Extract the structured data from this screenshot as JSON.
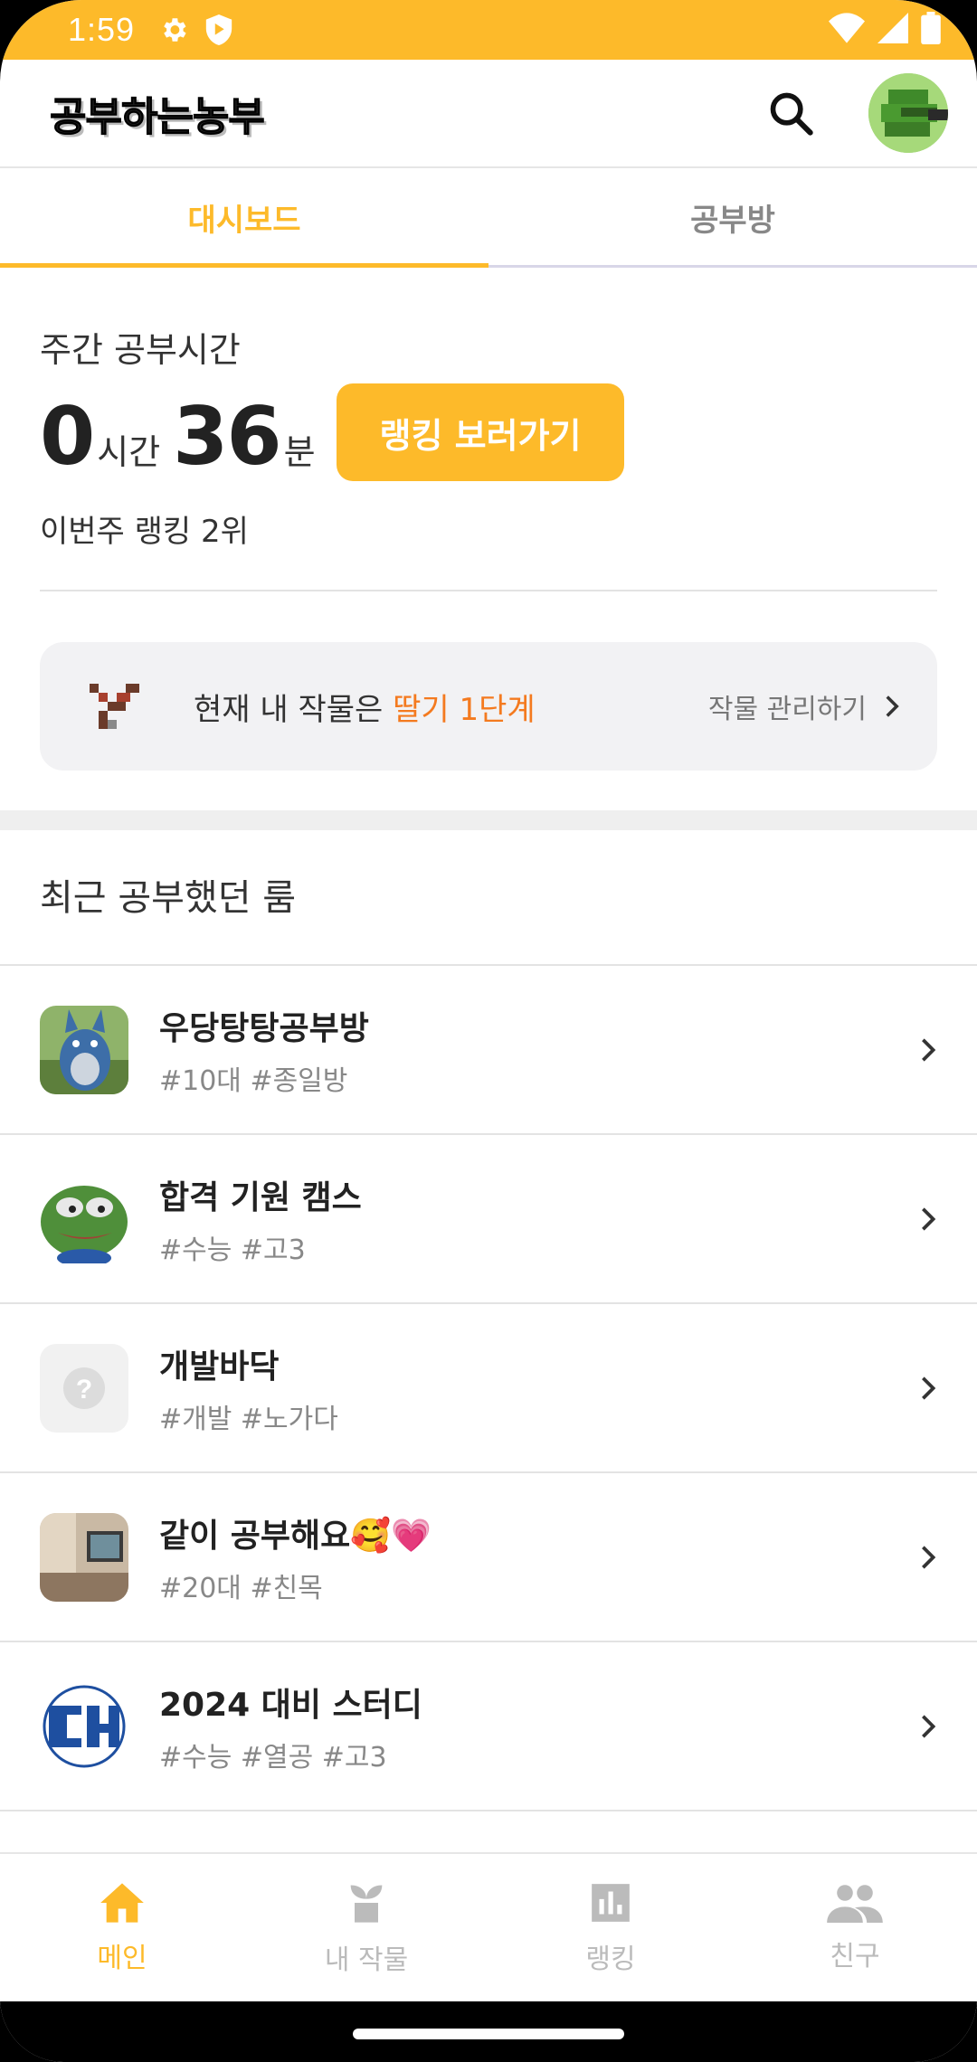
{
  "status_bar": {
    "time": "1:59"
  },
  "app_bar": {
    "logo": "공부하는농부"
  },
  "tabs": [
    {
      "label": "대시보드",
      "active": true
    },
    {
      "label": "공부방",
      "active": false
    }
  ],
  "weekly": {
    "label": "주간 공부시간",
    "hours": "0",
    "hours_unit": "시간",
    "minutes": "36",
    "minutes_unit": "분",
    "ranking_button": "랭킹 보러가기",
    "rank_text": "이번주 랭킹 2위"
  },
  "crop": {
    "prefix": "현재 내 작물은 ",
    "crop_name": "딸기 1단계",
    "manage_label": "작물 관리하기"
  },
  "recent": {
    "title": "최근 공부했던 룸",
    "rooms": [
      {
        "name": "우당탕탕공부방",
        "tags": "#10대 #종일방"
      },
      {
        "name": "합격 기원 캠스",
        "tags": "#수능 #고3"
      },
      {
        "name": "개발바닥",
        "tags": "#개발 #노가다"
      },
      {
        "name": "같이 공부해요🥰💗",
        "tags": "#20대 #친목"
      },
      {
        "name": "2024 대비 스터디",
        "tags": "#수능 #열공 #고3"
      }
    ]
  },
  "bottom_nav": [
    {
      "label": "메인",
      "icon": "home-icon",
      "active": true
    },
    {
      "label": "내 작물",
      "icon": "sprout-icon",
      "active": false
    },
    {
      "label": "랭킹",
      "icon": "bar-chart-icon",
      "active": false
    },
    {
      "label": "친구",
      "icon": "people-icon",
      "active": false
    }
  ],
  "colors": {
    "accent": "#FDBA2A",
    "highlight": "#F47A1F"
  }
}
